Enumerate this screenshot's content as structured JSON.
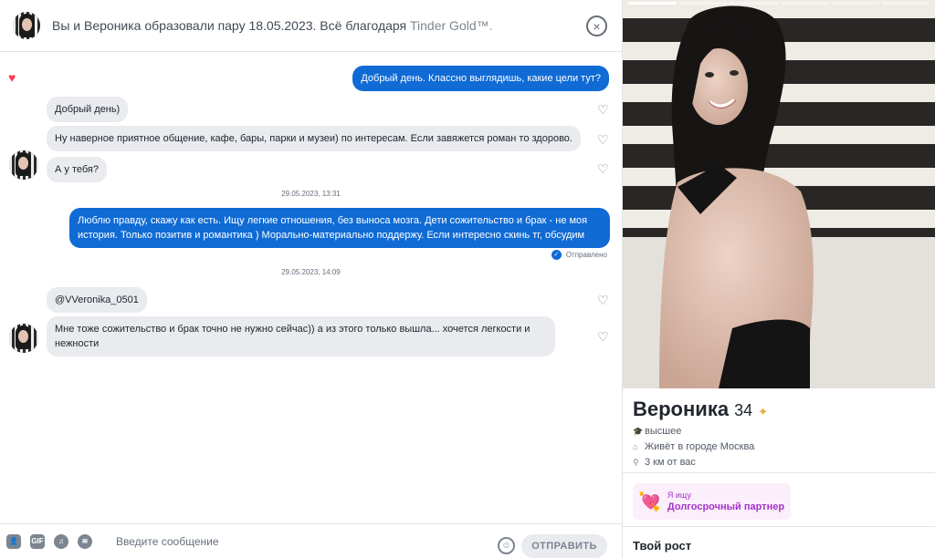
{
  "header": {
    "match_text": "Вы и Вероника образовали пару 18.05.2023. Всё благодаря",
    "gold_text": "Tinder Gold™.",
    "close_icon": "×"
  },
  "messages": [
    {
      "dir": "out",
      "text": "Добрый день. Классно выглядишь, какие цели тут?",
      "liked": true
    },
    {
      "dir": "in",
      "text": "Добрый день)"
    },
    {
      "dir": "in",
      "text": "Ну наверное приятное общение, кафе, бары, парки и музеи) по интересам. Если завяжется роман то здорово."
    },
    {
      "dir": "in",
      "text": "А у тебя?"
    },
    {
      "dir": "out",
      "text": "Люблю правду, скажу как есть. Ищу легкие отношения, без выноса мозга. Дети сожительство и брак - не моя история. Только позитив и романтика ) Морально-материально поддержу. Если интересно скинь тг, обсудим"
    },
    {
      "dir": "in",
      "text": "@VVeronika_0501"
    },
    {
      "dir": "in",
      "text": "Мне тоже сожительство и брак точно не нужно сейчас)) а из этого только вышла... хочется легкости и нежности"
    }
  ],
  "timestamps": [
    "29.05.2023, 13:31",
    "29.05.2023, 14:09"
  ],
  "sent_status": "Отправлено",
  "composer": {
    "gif_label": "GIF",
    "placeholder": "Введите сообщение",
    "send_label": "ОТПРАВИТЬ"
  },
  "profile": {
    "name": "Вероника",
    "age": "34",
    "education": "высшее",
    "city": "Живёт в городе Москва",
    "distance": "3 км от вас",
    "looking_caption": "Я ищу",
    "looking_value": "Долгосрочный партнер",
    "height_title": "Твой рост"
  },
  "colors": {
    "accent_blue": "#106bd5",
    "like_red": "#fd3b56",
    "looking_purple": "#a633c9"
  },
  "icons": {
    "like": "heart-icon",
    "close": "close-circle-icon",
    "emoji": "smile-icon",
    "education": "graduation-cap-icon",
    "city": "house-icon",
    "distance": "location-pin-icon",
    "verified": "sparkle-badge-icon"
  }
}
